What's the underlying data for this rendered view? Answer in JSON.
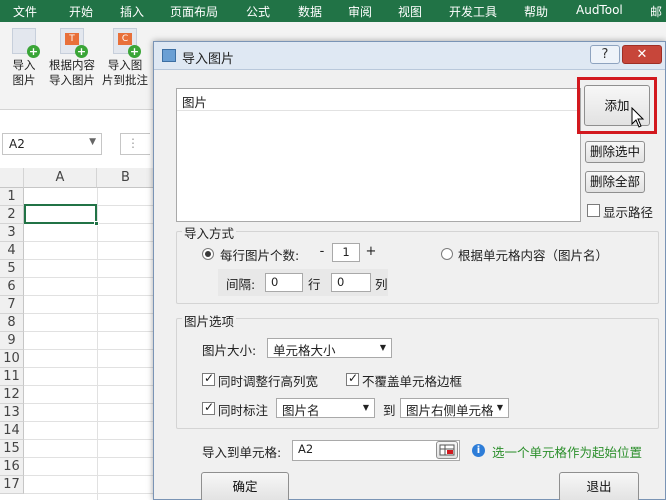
{
  "menu": [
    "文件",
    "开始",
    "插入",
    "页面布局",
    "公式",
    "数据",
    "审阅",
    "视图",
    "开发工具",
    "帮助",
    "AudTool",
    "邮"
  ],
  "ribbon": {
    "buttons": [
      {
        "line1": "导入",
        "line2": "图片",
        "icon": "import-picture-icon"
      },
      {
        "line1": "根据内容",
        "line2": "导入图片",
        "icon": "import-by-content-icon"
      },
      {
        "line1": "导入图",
        "line2": "片到批注",
        "icon": "import-to-comment-icon"
      }
    ]
  },
  "namebox": {
    "value": "A2"
  },
  "grid": {
    "columns": [
      "A",
      "B"
    ],
    "rows": [
      "1",
      "2",
      "3",
      "4",
      "5",
      "6",
      "7",
      "8",
      "9",
      "10",
      "11",
      "12",
      "13",
      "14",
      "15",
      "16",
      "17"
    ],
    "active_cell": "A2"
  },
  "dialog": {
    "title": "导入图片",
    "help": "?",
    "close": "✕",
    "list_header": "图片",
    "add": "添加",
    "delete_selected": "删除选中",
    "delete_all": "删除全部",
    "show_path": "显示路径",
    "show_path_checked": false,
    "import_mode": {
      "title": "导入方式",
      "per_row_label": "每行图片个数:",
      "per_row_value": "1",
      "minus": "-",
      "plus": "+",
      "by_content_label": "根据单元格内容（图片名）",
      "selected": "per_row",
      "spacing_label": "间隔:",
      "spacing_rows": "0",
      "rows_unit": "行",
      "spacing_cols": "0",
      "cols_unit": "列"
    },
    "options": {
      "title": "图片选项",
      "size_label": "图片大小:",
      "size_value": "单元格大小",
      "adjust_label": "同时调整行高列宽",
      "adjust_checked": true,
      "no_cover_label": "不覆盖单元格边框",
      "no_cover_checked": true,
      "annotate_label": "同时标注",
      "annotate_checked": true,
      "annotate_value": "图片名",
      "to_label": "到",
      "target_value": "图片右侧单元格"
    },
    "import_to": {
      "label": "导入到单元格:",
      "value": "A2",
      "hint": "选一个单元格作为起始位置"
    },
    "ok": "确定",
    "exit": "退出"
  },
  "colors": {
    "excel_green": "#217346",
    "highlight_red": "#d2181e"
  }
}
